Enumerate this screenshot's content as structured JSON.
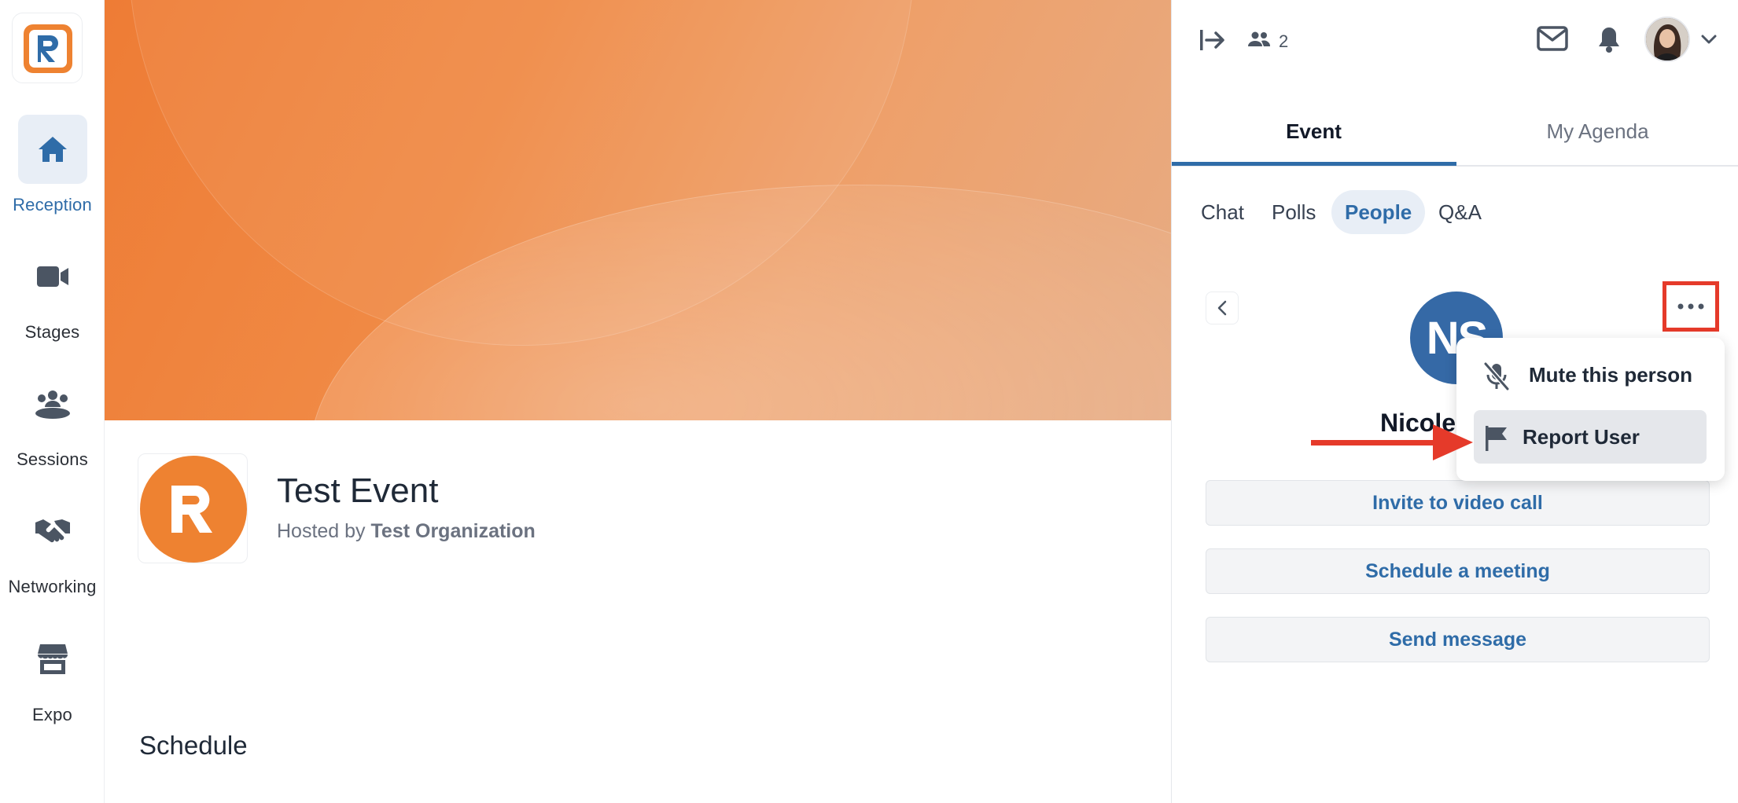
{
  "nav": {
    "items": [
      {
        "label": "Reception",
        "icon": "home-icon",
        "active": true
      },
      {
        "label": "Stages",
        "icon": "video-camera-icon"
      },
      {
        "label": "Sessions",
        "icon": "group-icon"
      },
      {
        "label": "Networking",
        "icon": "handshake-icon"
      },
      {
        "label": "Expo",
        "icon": "booth-icon"
      }
    ]
  },
  "event": {
    "title": "Test Event",
    "hosted_by": "Hosted by",
    "organization": "Test Organization",
    "schedule_heading": "Schedule"
  },
  "topbar": {
    "attendee_count": "2"
  },
  "tabs": {
    "event": "Event",
    "my_agenda": "My Agenda"
  },
  "subtabs": {
    "chat": "Chat",
    "polls": "Polls",
    "people": "People",
    "qa": "Q&A"
  },
  "profile": {
    "initials": "NS",
    "name": "Nicole"
  },
  "menu": {
    "mute": "Mute this person",
    "report": "Report User"
  },
  "actions": {
    "invite": "Invite to video call",
    "schedule": "Schedule a meeting",
    "message": "Send message"
  },
  "colors": {
    "accent": "#2f6ca8",
    "brand_orange": "#ee8231",
    "highlight_red": "#e53a2a",
    "avatar_blue": "#3569a6"
  }
}
